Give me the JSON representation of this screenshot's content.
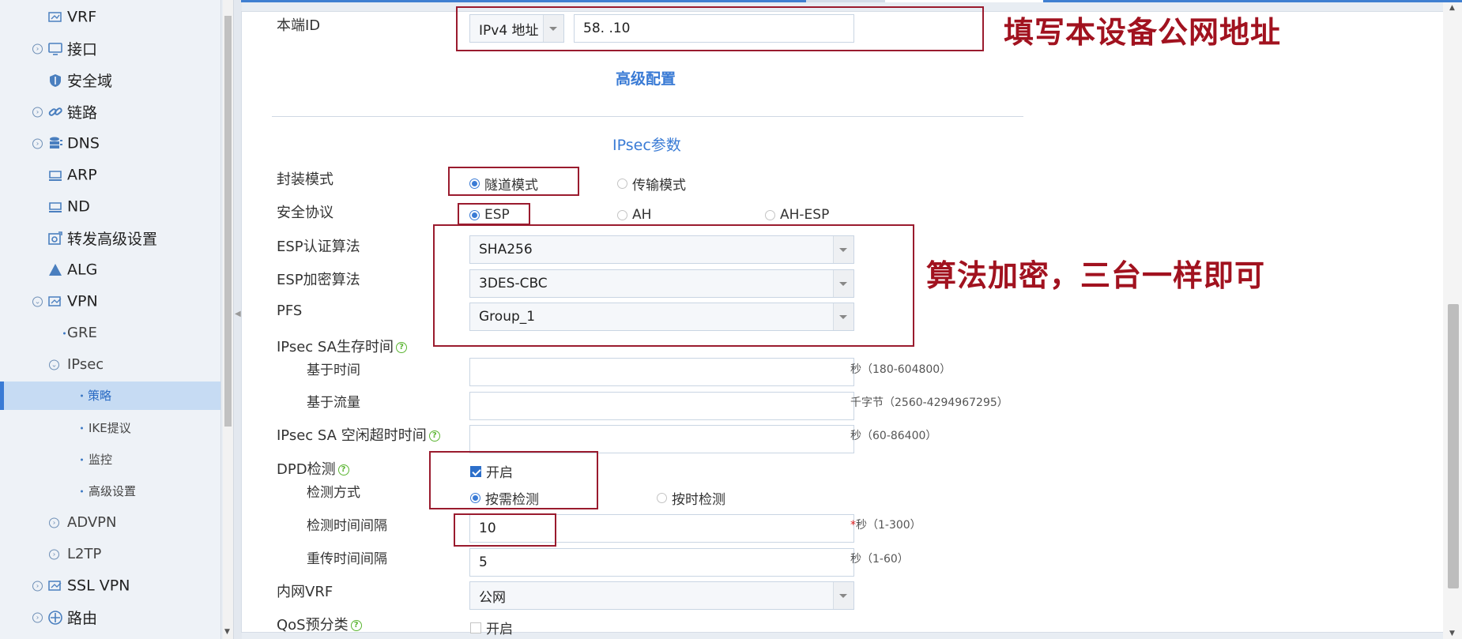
{
  "sidebar": {
    "items": [
      {
        "label": "VRF"
      },
      {
        "label": "接口"
      },
      {
        "label": "安全域"
      },
      {
        "label": "链路"
      },
      {
        "label": "DNS"
      },
      {
        "label": "ARP"
      },
      {
        "label": "ND"
      },
      {
        "label": "转发高级设置"
      },
      {
        "label": "ALG"
      },
      {
        "label": "VPN"
      },
      {
        "label": "GRE"
      },
      {
        "label": "IPsec"
      },
      {
        "label": "策略"
      },
      {
        "label": "IKE提议"
      },
      {
        "label": "监控"
      },
      {
        "label": "高级设置"
      },
      {
        "label": "ADVPN"
      },
      {
        "label": "L2TP"
      },
      {
        "label": "SSL VPN"
      },
      {
        "label": "路由"
      }
    ]
  },
  "form": {
    "local_id": {
      "label": "本端ID",
      "type_value": "IPv4 地址",
      "address_value": "58.        .10"
    },
    "advanced_link": "高级配置",
    "ipsec_section": "IPsec参数",
    "encap": {
      "label": "封装模式",
      "opt1": "隧道模式",
      "opt2": "传输模式"
    },
    "protocol": {
      "label": "安全协议",
      "opt1": "ESP",
      "opt2": "AH",
      "opt3": "AH-ESP"
    },
    "esp_auth": {
      "label": "ESP认证算法",
      "value": "SHA256"
    },
    "esp_enc": {
      "label": "ESP加密算法",
      "value": "3DES-CBC"
    },
    "pfs": {
      "label": "PFS",
      "value": "Group_1"
    },
    "sa_lifetime": {
      "label": "IPsec SA生存时间"
    },
    "time_based": {
      "label": "基于时间",
      "value": "",
      "hint": "秒（180-604800）"
    },
    "traffic_based": {
      "label": "基于流量",
      "value": "",
      "hint": "千字节（2560-4294967295）"
    },
    "idle_timeout": {
      "label": "IPsec SA 空闲超时时间",
      "value": "",
      "hint": "秒（60-86400）"
    },
    "dpd": {
      "label": "DPD检测",
      "check_label": "开启"
    },
    "dpd_mode": {
      "label": "检测方式",
      "opt1": "按需检测",
      "opt2": "按时检测"
    },
    "dpd_interval": {
      "label": "检测时间间隔",
      "value": "10",
      "star": "*",
      "hint": "秒（1-300）"
    },
    "retrans": {
      "label": "重传时间间隔",
      "value": "5",
      "hint": "秒（1-60）"
    },
    "inner_vrf": {
      "label": "内网VRF",
      "value": "公网"
    },
    "qos": {
      "label": "QoS预分类",
      "check_label": "开启"
    }
  },
  "annotations": {
    "note1": "填写本设备公网地址",
    "note2": "算法加密，三台一样即可"
  },
  "help_glyph": "?"
}
